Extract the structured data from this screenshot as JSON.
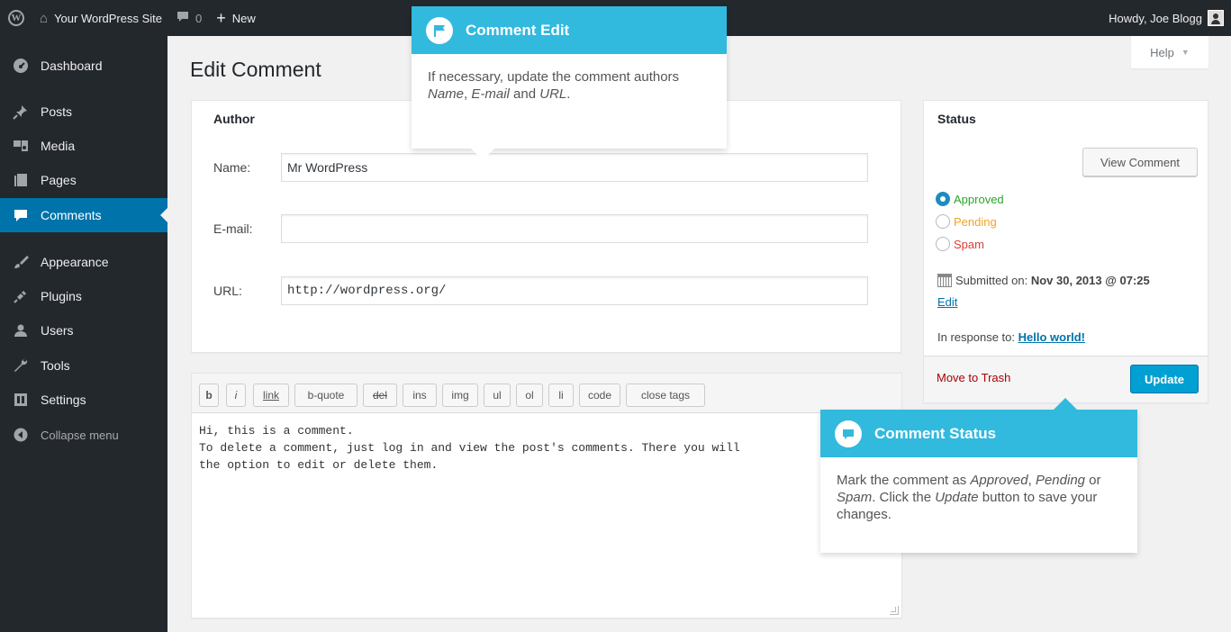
{
  "admin_bar": {
    "site_name": "Your WordPress Site",
    "comments_count": "0",
    "new_label": "New",
    "howdy": "Howdy, Joe Blogg"
  },
  "sidebar": {
    "items": [
      {
        "label": "Dashboard",
        "icon": "dashboard-icon"
      },
      {
        "label": "Posts",
        "icon": "pin-icon"
      },
      {
        "label": "Media",
        "icon": "media-icon"
      },
      {
        "label": "Pages",
        "icon": "pages-icon"
      },
      {
        "label": "Comments",
        "icon": "comment-icon",
        "current": true
      },
      {
        "label": "Appearance",
        "icon": "brush-icon"
      },
      {
        "label": "Plugins",
        "icon": "plug-icon"
      },
      {
        "label": "Users",
        "icon": "users-icon"
      },
      {
        "label": "Tools",
        "icon": "wrench-icon"
      },
      {
        "label": "Settings",
        "icon": "settings-icon"
      }
    ],
    "collapse_label": "Collapse menu"
  },
  "help_label": "Help",
  "page_title": "Edit Comment",
  "author": {
    "title": "Author",
    "name_label": "Name:",
    "name_value": "Mr WordPress",
    "email_label": "E-mail:",
    "email_value": "",
    "url_label": "URL:",
    "url_value": "http://wordpress.org/"
  },
  "editor": {
    "buttons": [
      "b",
      "i",
      "link",
      "b-quote",
      "del",
      "ins",
      "img",
      "ul",
      "ol",
      "li",
      "code",
      "close tags"
    ],
    "content": "Hi, this is a comment.\nTo delete a comment, just log in and view the post's comments. There you will\nthe option to edit or delete them."
  },
  "status": {
    "title": "Status",
    "view_comment": "View Comment",
    "options": [
      {
        "label": "Approved",
        "checked": true,
        "color": "#2ea32e"
      },
      {
        "label": "Pending",
        "checked": false,
        "color": "#f0a42a"
      },
      {
        "label": "Spam",
        "checked": false,
        "color": "#dd3d36"
      }
    ],
    "submitted_prefix": "Submitted on:",
    "submitted_date": "Nov 30, 2013 @ 07:25",
    "edit_label": "Edit",
    "in_response_prefix": "In response to:",
    "in_response_link": "Hello world!",
    "move_to_trash": "Move to Trash",
    "update": "Update"
  },
  "tooltips": {
    "edit": {
      "title": "Comment Edit",
      "body_pre": "If necessary, update the comment authors ",
      "em1": "Name",
      "sep1": ", ",
      "em2": "E-mail",
      "sep2": " and ",
      "em3": "URL",
      "body_end": "."
    },
    "status": {
      "title": "Comment Status",
      "body_pre": "Mark the comment as ",
      "em1": "Approved",
      "sep1": ", ",
      "em2": "Pending",
      "sep2": " or ",
      "em3": "Spam",
      "sep3": ". Click the ",
      "em4": "Update",
      "body_end": " button to save your changes."
    }
  },
  "colors": {
    "admin_bg": "#23282d",
    "accent": "#0073aa",
    "tooltip_header": "#32b9de",
    "update_button": "#00a0d2"
  }
}
